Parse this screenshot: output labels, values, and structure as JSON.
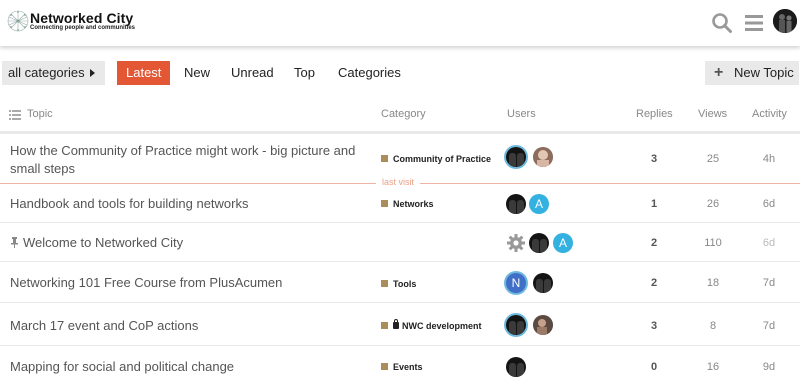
{
  "site": {
    "title": "Networked City",
    "tagline": "Connecting people and communities"
  },
  "header": {
    "search_icon": "search-icon",
    "menu_icon": "hamburger-menu-icon",
    "avatar": "user-avatar"
  },
  "nav": {
    "category_dropdown": "all categories",
    "tabs": [
      "Latest",
      "New",
      "Unread",
      "Top",
      "Categories"
    ],
    "active_tab": "Latest",
    "new_topic": "New Topic"
  },
  "table": {
    "columns": {
      "topic": "Topic",
      "category": "Category",
      "users": "Users",
      "replies": "Replies",
      "views": "Views",
      "activity": "Activity"
    },
    "last_visit_label": "last visit",
    "rows": [
      {
        "title": "How the Community of Practice might work - big picture and small steps",
        "category": "Community of Practice",
        "replies": "3",
        "views": "25",
        "activity": "4h"
      },
      {
        "title": "Handbook and tools for building networks",
        "category": "Networks",
        "replies": "1",
        "views": "26",
        "activity": "6d"
      },
      {
        "title": "Welcome to Networked City",
        "category": "",
        "pinned": true,
        "replies": "2",
        "views": "110",
        "activity": "6d"
      },
      {
        "title": "Networking 101 Free Course from PlusAcumen",
        "category": "Tools",
        "replies": "2",
        "views": "18",
        "activity": "7d"
      },
      {
        "title": "March 17 event and CoP actions",
        "category": "NWC development",
        "locked": true,
        "replies": "3",
        "views": "8",
        "activity": "7d"
      },
      {
        "title": "Mapping for social and political change",
        "category": "Events",
        "replies": "0",
        "views": "16",
        "activity": "9d"
      }
    ],
    "avatar_letters": {
      "row2": "A",
      "row3": "A",
      "row4": "N"
    }
  },
  "colors": {
    "accent": "#e45735",
    "category_square": "#a98e5c",
    "letter_avatar": "#33b1e0",
    "last_visit_line": "#f0b5a5"
  }
}
